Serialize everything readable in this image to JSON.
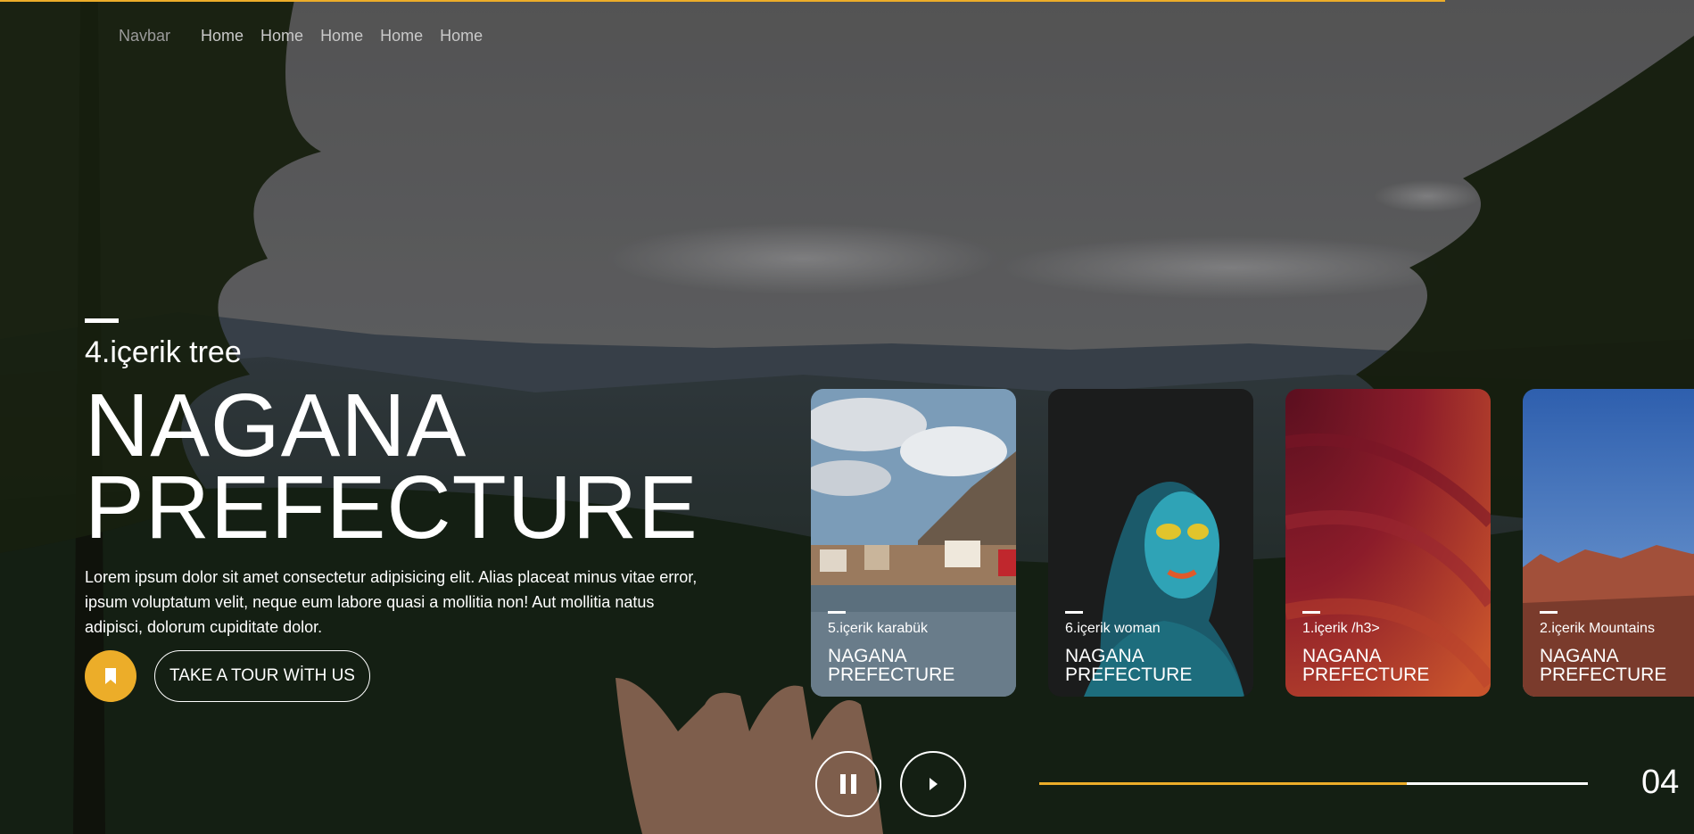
{
  "colors": {
    "accent": "#ecad29"
  },
  "navbar": {
    "brand": "Navbar",
    "links": [
      "Home",
      "Home",
      "Home",
      "Home",
      "Home"
    ]
  },
  "hero": {
    "subtitle": "4.içerik tree",
    "title_line1": "NAGANA",
    "title_line2": "PREFECTURE",
    "description": "Lorem ipsum dolor sit amet consectetur adipisicing elit. Alias placeat minus vitae error, ipsum voluptatum velit, neque eum labore quasi a mollitia non! Aut mollitia natus adipisci, dolorum cupiditate dolor.",
    "bookmark_icon": "bookmark-icon",
    "tour_button": "TAKE A TOUR WİTH US"
  },
  "cards": [
    {
      "subtitle": "5.içerik karabük",
      "title_line1": "NAGANA",
      "title_line2": "PREFECTURE"
    },
    {
      "subtitle": "6.içerik woman",
      "title_line1": "NAGANA",
      "title_line2": "PREFECTURE"
    },
    {
      "subtitle": "1.içerik /h3>",
      "title_line1": "NAGANA",
      "title_line2": "PREFECTURE"
    },
    {
      "subtitle": "2.içerik Mountains",
      "title_line1": "NAGANA",
      "title_line2": "PREFECTURE"
    }
  ],
  "controls": {
    "pause_icon": "pause-icon",
    "next_icon": "play-icon",
    "slide_number": "04",
    "progress": 0.67
  }
}
